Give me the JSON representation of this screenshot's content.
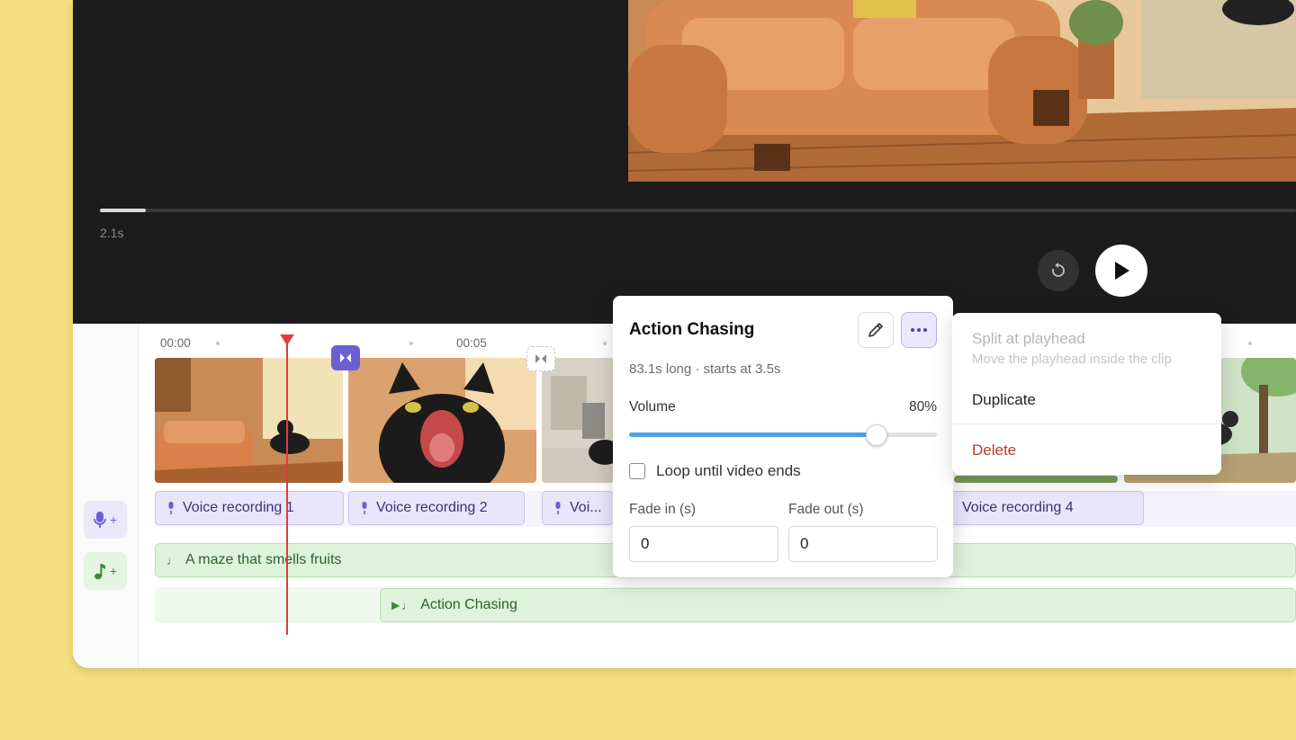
{
  "player": {
    "time": "2.1s",
    "progress": 0.038
  },
  "ruler": {
    "t0": "00:00",
    "t5": "00:05"
  },
  "voice_track": {
    "clips": [
      "Voice recording 1",
      "Voice recording 2",
      "Voi...",
      "Voice recording 4"
    ]
  },
  "music_track": {
    "clip1": "A maze that smells fruits",
    "clip2": "Action Chasing"
  },
  "popover": {
    "title": "Action Chasing",
    "subtitle": "83.1s long · starts at 3.5s",
    "volume_label": "Volume",
    "volume_value": "80%",
    "volume_level": 0.8,
    "loop_label": "Loop until video ends",
    "loop_checked": false,
    "fade_in_label": "Fade in (s)",
    "fade_out_label": "Fade out (s)",
    "fade_in_value": "0",
    "fade_out_value": "0"
  },
  "menu": {
    "split_label": "Split at playhead",
    "split_hint": "Move the playhead inside the clip",
    "duplicate_label": "Duplicate",
    "delete_label": "Delete"
  },
  "colors": {
    "page_bg": "#f4de80",
    "accent_blue": "#4aa3e8",
    "voice_purple": "#6b5fd3",
    "music_green": "#3b8a36",
    "playhead_red": "#e13b3b",
    "delete_red": "#c0392b"
  }
}
